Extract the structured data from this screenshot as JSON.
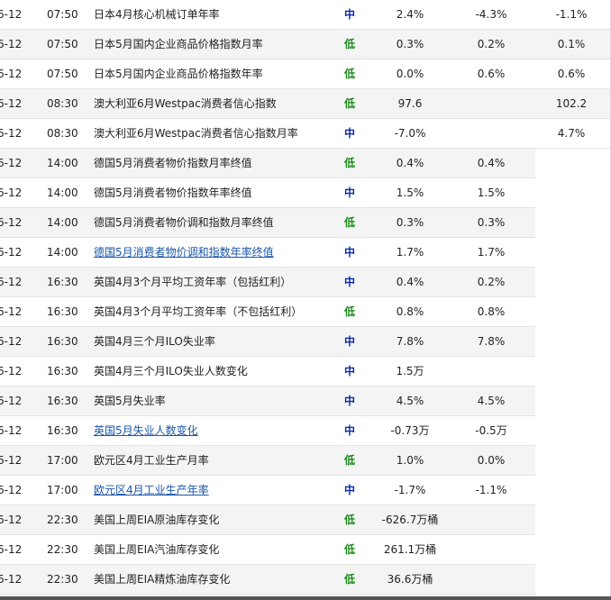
{
  "level_colors": {
    "中": "#0a2aa8",
    "低": "#1a8a1a"
  },
  "rows": [
    {
      "date": "6-12",
      "time": "07:50",
      "event": "日本4月核心机械订单年率",
      "level": "中",
      "previous": "2.4%",
      "forecast": "-4.3%",
      "actual": "-1.1%",
      "link": false
    },
    {
      "date": "6-12",
      "time": "07:50",
      "event": "日本5月国内企业商品价格指数月率",
      "level": "低",
      "previous": "0.3%",
      "forecast": "0.2%",
      "actual": "0.1%",
      "link": false
    },
    {
      "date": "6-12",
      "time": "07:50",
      "event": "日本5月国内企业商品价格指数年率",
      "level": "低",
      "previous": "0.0%",
      "forecast": "0.6%",
      "actual": "0.6%",
      "link": false
    },
    {
      "date": "6-12",
      "time": "08:30",
      "event": "澳大利亚6月Westpac消费者信心指数",
      "level": "低",
      "previous": "97.6",
      "forecast": "",
      "actual": "102.2",
      "link": false
    },
    {
      "date": "6-12",
      "time": "08:30",
      "event": "澳大利亚6月Westpac消费者信心指数月率",
      "level": "中",
      "previous": "-7.0%",
      "forecast": "",
      "actual": "4.7%",
      "link": false
    },
    {
      "date": "6-12",
      "time": "14:00",
      "event": "德国5月消费者物价指数月率终值",
      "level": "低",
      "previous": "0.4%",
      "forecast": "0.4%",
      "actual": "",
      "link": false
    },
    {
      "date": "6-12",
      "time": "14:00",
      "event": "德国5月消费者物价指数年率终值",
      "level": "中",
      "previous": "1.5%",
      "forecast": "1.5%",
      "actual": "",
      "link": false
    },
    {
      "date": "6-12",
      "time": "14:00",
      "event": "德国5月消费者物价调和指数月率终值",
      "level": "低",
      "previous": "0.3%",
      "forecast": "0.3%",
      "actual": "",
      "link": false
    },
    {
      "date": "6-12",
      "time": "14:00",
      "event": "德国5月消费者物价调和指数年率终值",
      "level": "中",
      "previous": "1.7%",
      "forecast": "1.7%",
      "actual": "",
      "link": true
    },
    {
      "date": "6-12",
      "time": "16:30",
      "event": "英国4月3个月平均工资年率（包括红利）",
      "level": "中",
      "previous": "0.4%",
      "forecast": "0.2%",
      "actual": "",
      "link": false
    },
    {
      "date": "6-12",
      "time": "16:30",
      "event": "英国4月3个月平均工资年率（不包括红利）",
      "level": "低",
      "previous": "0.8%",
      "forecast": "0.8%",
      "actual": "",
      "link": false
    },
    {
      "date": "6-12",
      "time": "16:30",
      "event": "英国4月三个月ILO失业率",
      "level": "中",
      "previous": "7.8%",
      "forecast": "7.8%",
      "actual": "",
      "link": false
    },
    {
      "date": "6-12",
      "time": "16:30",
      "event": "英国4月三个月ILO失业人数变化",
      "level": "中",
      "previous": "1.5万",
      "forecast": "",
      "actual": "",
      "link": false
    },
    {
      "date": "6-12",
      "time": "16:30",
      "event": "英国5月失业率",
      "level": "中",
      "previous": "4.5%",
      "forecast": "4.5%",
      "actual": "",
      "link": false
    },
    {
      "date": "6-12",
      "time": "16:30",
      "event": "英国5月失业人数变化",
      "level": "中",
      "previous": "-0.73万",
      "forecast": "-0.5万",
      "actual": "",
      "link": true
    },
    {
      "date": "6-12",
      "time": "17:00",
      "event": "欧元区4月工业生产月率",
      "level": "低",
      "previous": "1.0%",
      "forecast": "0.0%",
      "actual": "",
      "link": false
    },
    {
      "date": "6-12",
      "time": "17:00",
      "event": "欧元区4月工业生产年率",
      "level": "中",
      "previous": "-1.7%",
      "forecast": "-1.1%",
      "actual": "",
      "link": true
    },
    {
      "date": "6-12",
      "time": "22:30",
      "event": "美国上周EIA原油库存变化",
      "level": "低",
      "previous": "-626.7万桶",
      "forecast": "",
      "actual": "",
      "link": false
    },
    {
      "date": "6-12",
      "time": "22:30",
      "event": "美国上周EIA汽油库存变化",
      "level": "低",
      "previous": "261.1万桶",
      "forecast": "",
      "actual": "",
      "link": false
    },
    {
      "date": "6-12",
      "time": "22:30",
      "event": "美国上周EIA精炼油库存变化",
      "level": "低",
      "previous": "36.6万桶",
      "forecast": "",
      "actual": "",
      "link": false
    }
  ]
}
